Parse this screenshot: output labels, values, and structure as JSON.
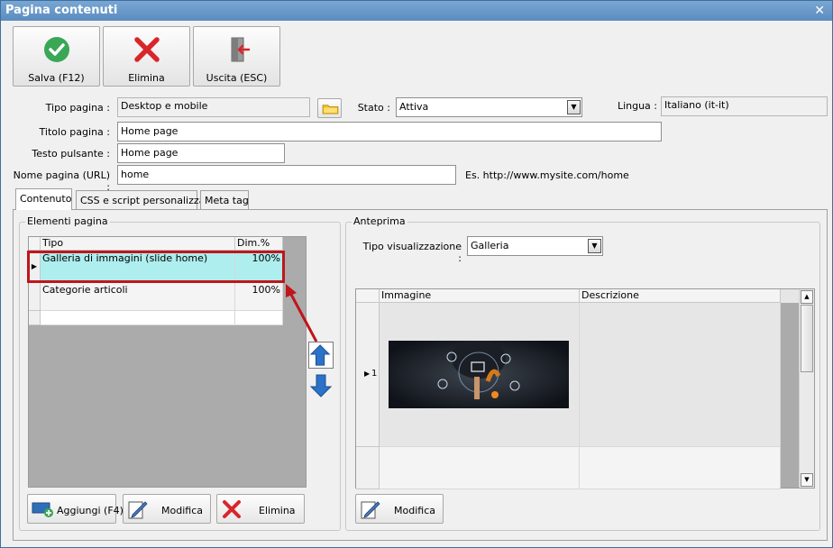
{
  "window": {
    "title": "Pagina contenuti",
    "close_glyph": "✕"
  },
  "toolbar": {
    "save_label": "Salva (F12)",
    "delete_label": "Elimina",
    "exit_label": "Uscita (ESC)"
  },
  "form": {
    "tipo_pagina_label": "Tipo pagina :",
    "tipo_pagina_value": "Desktop e mobile",
    "stato_label": "Stato :",
    "stato_value": "Attiva",
    "lingua_label": "Lingua :",
    "lingua_value": "Italiano (it-it)",
    "titolo_label": "Titolo pagina :",
    "titolo_value": "Home page",
    "testo_pulsante_label": "Testo pulsante :",
    "testo_pulsante_value": "Home page",
    "nome_pagina_label": "Nome pagina (URL) :",
    "nome_pagina_value": "home",
    "url_example": "Es. http://www.mysite.com/home"
  },
  "tabs": [
    {
      "label": "Contenuto",
      "active": true
    },
    {
      "label": "CSS e script personalizzati",
      "active": false
    },
    {
      "label": "Meta tag",
      "active": false
    }
  ],
  "elementi": {
    "title": "Elementi pagina",
    "columns": [
      "Tipo",
      "Dim.%"
    ],
    "rows": [
      {
        "tipo": "Galleria di immagini (slide home)",
        "dim": "100%",
        "selected": true
      },
      {
        "tipo": "Categorie articoli",
        "dim": "100%",
        "selected": false
      }
    ],
    "add_label": "Aggiungi (F4)",
    "edit_label": "Modifica",
    "delete_label": "Elimina"
  },
  "anteprima": {
    "title": "Anteprima",
    "tipo_label": "Tipo visualizzazione :",
    "tipo_value": "Galleria",
    "columns": [
      "Immagine",
      "Descrizione"
    ],
    "row_number": "1",
    "edit_label": "Modifica"
  },
  "colors": {
    "selected_row": "#aeeeee",
    "highlight_border": "#c0151b",
    "arrow_blue": "#2c72c7",
    "save_green": "#3aa757",
    "delete_red": "#d8262b"
  },
  "icons": {
    "save": "check-circle-icon",
    "delete": "red-x-icon",
    "exit": "door-exit-icon",
    "folder": "folder-icon",
    "move_up": "arrow-up-icon",
    "move_down": "arrow-down-icon",
    "add": "add-monitor-icon",
    "edit": "pencil-document-icon"
  }
}
